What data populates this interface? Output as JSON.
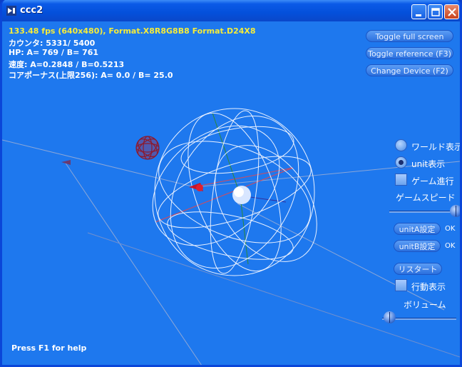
{
  "window": {
    "title": "ccc2",
    "title_icon": "directx-app-icon",
    "buttons": [
      "minimize-icon",
      "maximize-icon",
      "close-icon"
    ]
  },
  "stats": {
    "fps_line": "133.48 fps (640x480), Format.X8R8G8B8 Format.D24X8",
    "counter": "カウンタ:  5331/  5400",
    "hp": "HP: A=  769 / B=  761",
    "speed": "速度: A=0.2848 / B=0.5213",
    "core_points": "コアポーナス(上限256): A=  0.0 / B= 25.0"
  },
  "buttons": {
    "toggle_fullscreen": "Toggle full screen",
    "toggle_reference": "Toggle reference (F3)",
    "change_device": "Change Device (F2)"
  },
  "controls": {
    "world_view": {
      "label": "ワールド表示",
      "checked": false
    },
    "unit_view": {
      "label": "unit表示",
      "checked": true
    },
    "game_progress": {
      "label": "ゲーム進行",
      "checked": false
    },
    "game_speed": {
      "label": "ゲームスピード",
      "value": 1.0
    },
    "unitA_settings": {
      "label": "unitA設定",
      "status": "OK"
    },
    "unitB_settings": {
      "label": "unitB設定",
      "status": "OK"
    },
    "restart": "リスタート",
    "action_display": {
      "label": "行動表示",
      "checked": false
    },
    "volume": {
      "label": "ボリューム",
      "value": 0.0
    }
  },
  "help": "Press F1 for help",
  "colors": {
    "background": "#1e78ee",
    "fps_text": "#f5ec3a",
    "title_bar": "#0450db",
    "wireframe": "#e8f0ff",
    "unit_red": "#c4142a"
  }
}
